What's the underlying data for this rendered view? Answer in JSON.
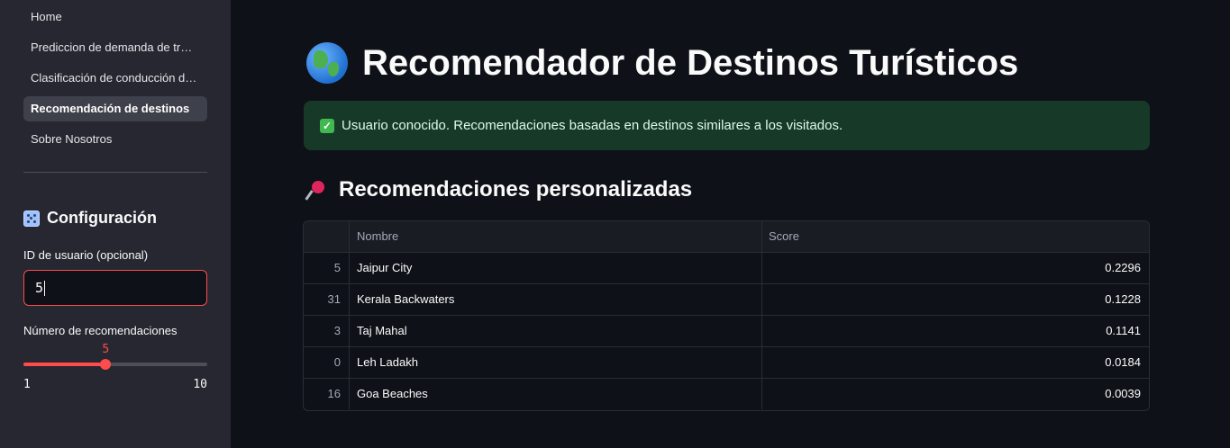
{
  "sidebar": {
    "nav": [
      {
        "label": "Home"
      },
      {
        "label": "Prediccion de demanda de tr…"
      },
      {
        "label": "Clasificación de conducción d…"
      },
      {
        "label": "Recomendación de destinos"
      },
      {
        "label": "Sobre Nosotros"
      }
    ],
    "active_index": 3,
    "config": {
      "title": "Configuración",
      "icon": "dice-icon",
      "user_id_label": "ID de usuario (opcional)",
      "user_id_value": "5",
      "num_recs_label": "Número de recomendaciones",
      "slider": {
        "value": 5,
        "min": 1,
        "max": 10,
        "value_text": "5",
        "min_text": "1",
        "max_text": "10"
      }
    }
  },
  "main": {
    "title": "Recomendador de Destinos Turísticos",
    "title_icon": "globe-icon",
    "alert": {
      "text": "Usuario conocido. Recomendaciones basadas en destinos similares a los visitados.",
      "icon": "check-icon"
    },
    "subtitle": "Recomendaciones personalizadas",
    "subtitle_icon": "pin-icon",
    "table": {
      "columns": [
        "",
        "Nombre",
        "Score"
      ],
      "rows": [
        {
          "index": "5",
          "nombre": "Jaipur City",
          "score": "0.2296"
        },
        {
          "index": "31",
          "nombre": "Kerala Backwaters",
          "score": "0.1228"
        },
        {
          "index": "3",
          "nombre": "Taj Mahal",
          "score": "0.1141"
        },
        {
          "index": "0",
          "nombre": "Leh Ladakh",
          "score": "0.0184"
        },
        {
          "index": "16",
          "nombre": "Goa Beaches",
          "score": "0.0039"
        }
      ]
    }
  },
  "colors": {
    "accent": "#ff4b4b",
    "success_bg": "#173928",
    "background": "#0e1117",
    "sidebar_bg": "#262730"
  }
}
